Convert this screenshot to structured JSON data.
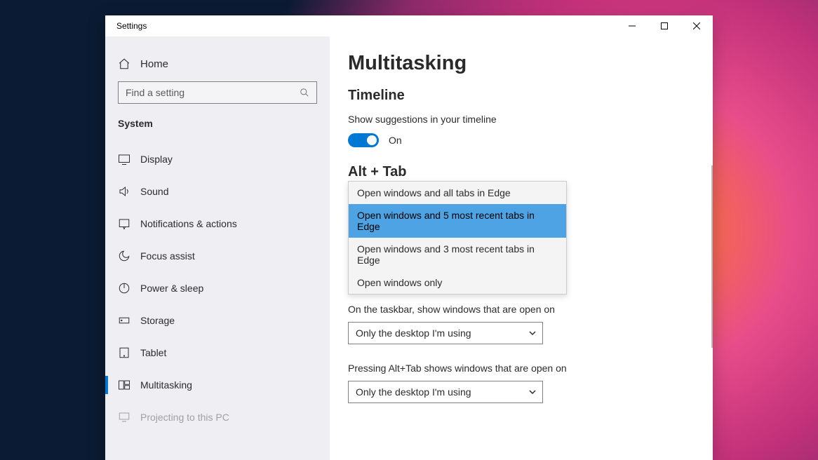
{
  "window": {
    "title": "Settings"
  },
  "sidebar": {
    "home": "Home",
    "search_placeholder": "Find a setting",
    "category": "System",
    "items": [
      {
        "id": "display",
        "label": "Display"
      },
      {
        "id": "sound",
        "label": "Sound"
      },
      {
        "id": "notifications",
        "label": "Notifications & actions"
      },
      {
        "id": "focus-assist",
        "label": "Focus assist"
      },
      {
        "id": "power-sleep",
        "label": "Power & sleep"
      },
      {
        "id": "storage",
        "label": "Storage"
      },
      {
        "id": "tablet",
        "label": "Tablet"
      },
      {
        "id": "multitasking",
        "label": "Multitasking",
        "active": true
      },
      {
        "id": "projecting",
        "label": "Projecting to this PC"
      }
    ]
  },
  "main": {
    "title": "Multitasking",
    "timeline": {
      "heading": "Timeline",
      "desc": "Show suggestions in your timeline",
      "toggle_label": "On",
      "toggle_on": true
    },
    "alttab": {
      "heading": "Alt + Tab",
      "options": [
        "Open windows and all tabs in Edge",
        "Open windows and 5 most recent tabs in Edge",
        "Open windows and 3 most recent tabs in Edge",
        "Open windows only"
      ],
      "selected_index": 1
    },
    "vd_taskbar": {
      "label": "On the taskbar, show windows that are open on",
      "value": "Only the desktop I'm using"
    },
    "vd_alttab": {
      "label": "Pressing Alt+Tab shows windows that are open on",
      "value": "Only the desktop I'm using"
    }
  }
}
